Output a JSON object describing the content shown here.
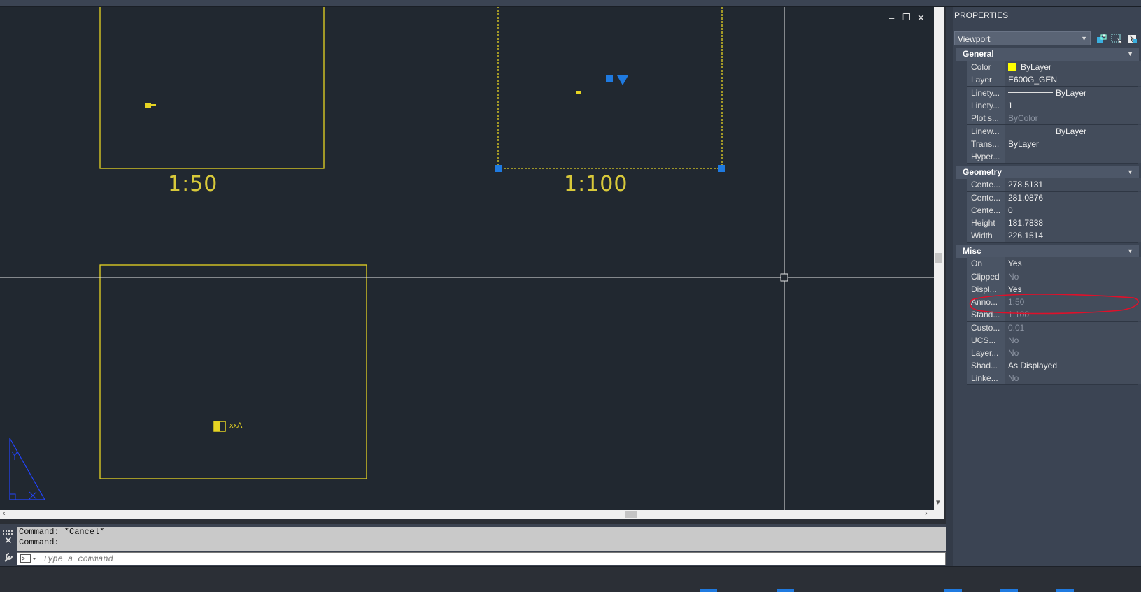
{
  "canvas": {
    "viewports": [
      {
        "scale_label": "1:50",
        "symbol_label": ""
      },
      {
        "scale_label": "1:100"
      },
      {
        "symbol_label": "xxA"
      }
    ],
    "controls": {
      "minimize": "‒",
      "restore": "❐",
      "close": "✕"
    },
    "colors": {
      "background": "#212830",
      "viewport_border": "#e6d423",
      "grip": "#1f7ae0",
      "crosshair": "#e8e8e8",
      "ucs": "#2244ff"
    }
  },
  "command_line": {
    "history": [
      "Command: *Cancel*",
      "Command:"
    ],
    "input_placeholder": "Type a command",
    "close_icon": "✕",
    "wrench_icon": "wrench-icon"
  },
  "properties": {
    "title": "PROPERTIES",
    "selector": "Viewport",
    "sections": [
      {
        "name": "General",
        "rows": [
          {
            "name": "Color",
            "value": "ByLayer",
            "swatch": "#ffff00"
          },
          {
            "name": "Layer",
            "value": "E600G_GEN"
          },
          {
            "name": "Linety...",
            "value": "ByLayer",
            "line": true
          },
          {
            "name": "Linety...",
            "value": "1"
          },
          {
            "name": "Plot s...",
            "value": "ByColor",
            "dim": true
          },
          {
            "name": "Linew...",
            "value": "ByLayer",
            "line": true
          },
          {
            "name": "Trans...",
            "value": "ByLayer"
          },
          {
            "name": "Hyper...",
            "value": ""
          }
        ]
      },
      {
        "name": "Geometry",
        "rows": [
          {
            "name": "Cente...",
            "value": "278.5131"
          },
          {
            "name": "Cente...",
            "value": "281.0876"
          },
          {
            "name": "Cente...",
            "value": "0"
          },
          {
            "name": "Height",
            "value": "181.7838"
          },
          {
            "name": "Width",
            "value": "226.1514"
          }
        ]
      },
      {
        "name": "Misc",
        "rows": [
          {
            "name": "On",
            "value": "Yes"
          },
          {
            "name": "Clipped",
            "value": "No",
            "dim": true
          },
          {
            "name": "Displ...",
            "value": "Yes"
          },
          {
            "name": "Anno...",
            "value": "1:50",
            "dim": true
          },
          {
            "name": "Stand...",
            "value": "1:100",
            "dim": true
          },
          {
            "name": "Custo...",
            "value": "0.01",
            "dim": true
          },
          {
            "name": "UCS...",
            "value": "No",
            "dim": true
          },
          {
            "name": "Layer...",
            "value": "No",
            "dim": true
          },
          {
            "name": "Shad...",
            "value": "As Displayed"
          },
          {
            "name": "Linke...",
            "value": "No",
            "dim": true
          }
        ]
      }
    ]
  }
}
